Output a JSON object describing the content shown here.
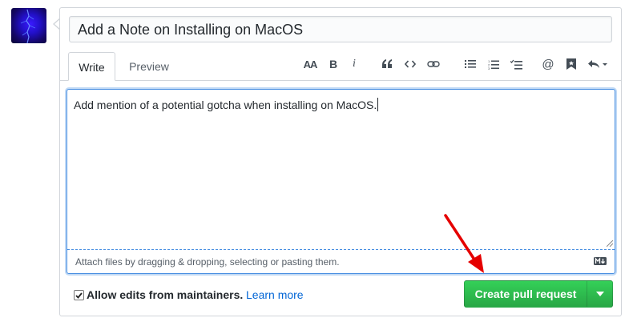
{
  "avatar": {
    "icon": "user-avatar-image"
  },
  "pr_form": {
    "title_value": "Add a Note on Installing on MacOS",
    "tabs": [
      {
        "label": "Write",
        "selected": true
      },
      {
        "label": "Preview",
        "selected": false
      }
    ],
    "toolbar": {
      "header_label": "AA",
      "bold_label": "B",
      "italic_label": "i",
      "icons": [
        "text-size-icon",
        "bold-icon",
        "italic-icon",
        "quote-icon",
        "code-icon",
        "link-icon",
        "bulleted-list-icon",
        "numbered-list-icon",
        "task-list-icon",
        "mention-icon",
        "saved-reply-icon",
        "reply-icon"
      ]
    },
    "body_value": "Add mention of a potential gotcha when installing on MacOS.",
    "attach_hint": "Attach files by dragging & dropping, selecting or pasting them.",
    "markdown_icon": "markdown-icon"
  },
  "footer": {
    "allow_edits_label": "Allow edits from maintainers.",
    "allow_edits_checked": true,
    "learn_more_label": "Learn more",
    "create_button_label": "Create pull request"
  },
  "colors": {
    "primary_button": "#2ea44f",
    "link": "#0366d6",
    "focus_border": "#4a90e2",
    "annotation_arrow": "#e50000"
  }
}
